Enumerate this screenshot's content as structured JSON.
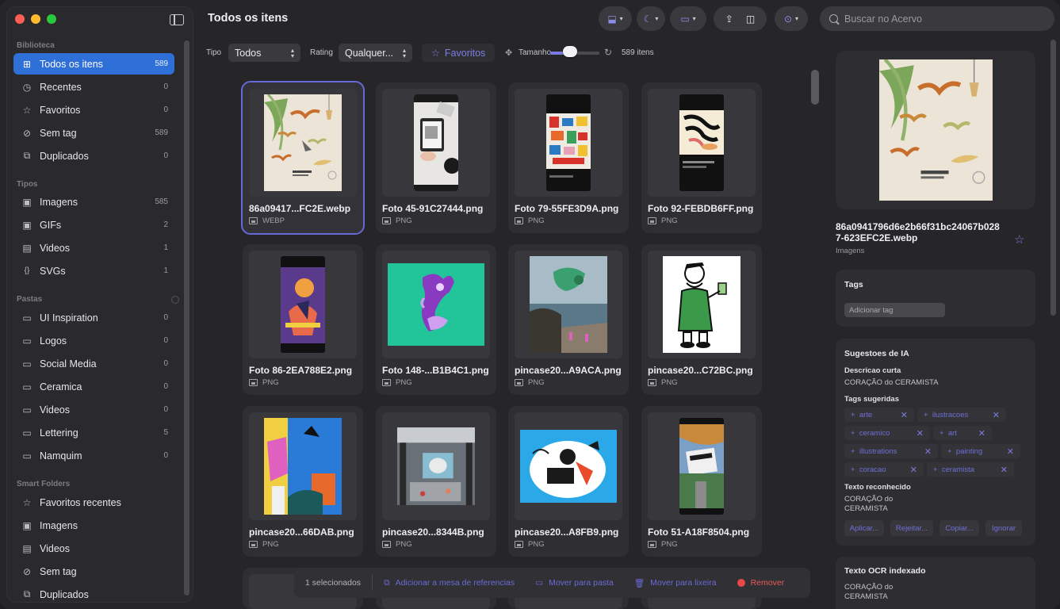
{
  "sidebar": {
    "sections": {
      "biblioteca": "Biblioteca",
      "tipos": "Tipos",
      "pastas": "Pastas",
      "smart": "Smart Folders"
    },
    "biblioteca": [
      {
        "label": "Todos os itens",
        "count": "589",
        "icon": "grid-icon"
      },
      {
        "label": "Recentes",
        "count": "0",
        "icon": "clock-icon"
      },
      {
        "label": "Favoritos",
        "count": "0",
        "icon": "star-icon"
      },
      {
        "label": "Sem tag",
        "count": "589",
        "icon": "tag-off-icon"
      },
      {
        "label": "Duplicados",
        "count": "0",
        "icon": "duplicate-icon"
      }
    ],
    "tipos": [
      {
        "label": "Imagens",
        "count": "585",
        "icon": "image-icon"
      },
      {
        "label": "GIFs",
        "count": "2",
        "icon": "gif-icon"
      },
      {
        "label": "Videos",
        "count": "1",
        "icon": "film-icon"
      },
      {
        "label": "SVGs",
        "count": "1",
        "icon": "braces-icon"
      }
    ],
    "pastas": [
      {
        "label": "UI Inspiration",
        "count": "0"
      },
      {
        "label": "Logos",
        "count": "0"
      },
      {
        "label": "Social Media",
        "count": "0"
      },
      {
        "label": "Ceramica",
        "count": "0"
      },
      {
        "label": "Videos",
        "count": "0"
      },
      {
        "label": "Lettering",
        "count": "5"
      },
      {
        "label": "Namquim",
        "count": "0"
      }
    ],
    "smart": [
      {
        "label": "Favoritos recentes",
        "icon": "star-icon"
      },
      {
        "label": "Imagens",
        "icon": "image-icon"
      },
      {
        "label": "Videos",
        "icon": "film-icon"
      },
      {
        "label": "Sem tag",
        "icon": "tag-off-icon"
      },
      {
        "label": "Duplicados",
        "icon": "duplicate-icon"
      }
    ]
  },
  "header": {
    "title": "Todos os itens",
    "search_placeholder": "Buscar no Acervo"
  },
  "filters": {
    "tipo_label": "Tipo",
    "tipo_value": "Todos",
    "rating_label": "Rating",
    "rating_value": "Qualquer...",
    "favoritos_label": "Favoritos",
    "tamanho_label": "Tamanho",
    "tamanho_level": 0.4,
    "count_text": "589 itens"
  },
  "grid": [
    {
      "name": "86a09417...FC2E.webp",
      "format": "WEBP"
    },
    {
      "name": "Foto 45-91C27444.png",
      "format": "PNG"
    },
    {
      "name": "Foto 79-55FE3D9A.png",
      "format": "PNG"
    },
    {
      "name": "Foto 92-FEBDB6FF.png",
      "format": "PNG"
    },
    {
      "name": "Foto 86-2EA788E2.png",
      "format": "PNG"
    },
    {
      "name": "Foto 148-...B1B4C1.png",
      "format": "PNG"
    },
    {
      "name": "pincase20...A9ACA.png",
      "format": "PNG"
    },
    {
      "name": "pincase20...C72BC.png",
      "format": "PNG"
    },
    {
      "name": "pincase20...66DAB.png",
      "format": "PNG"
    },
    {
      "name": "pincase20...8344B.png",
      "format": "PNG"
    },
    {
      "name": "pincase20...A8FB9.png",
      "format": "PNG"
    },
    {
      "name": "Foto 51-A18F8504.png",
      "format": "PNG"
    }
  ],
  "action_bar": {
    "selected": "1 selecionados",
    "add_ref": "Adicionar a mesa de referencias",
    "move_folder": "Mover para pasta",
    "move_trash": "Mover para lixeira",
    "remove": "Remover"
  },
  "details": {
    "file_name": "86a0941796d6e2b66f31bc24067b0287-623EFC2E.webp",
    "kind": "Imagens",
    "tags_title": "Tags",
    "add_tag_placeholder": "Adicionar tag",
    "ai_title": "Sugestoes de IA",
    "short_desc_label": "Descricao curta",
    "short_desc": "CORAÇÃO do CERAMISTA",
    "suggested_tags_label": "Tags sugeridas",
    "suggested_tags": [
      "arte",
      "ilustracoes",
      "ceramico",
      "art",
      "illustrations",
      "painting",
      "coracao",
      "ceramista"
    ],
    "recognized_label": "Texto reconhecido",
    "recognized_line1": "CORAÇÃO do",
    "recognized_line2": "CERAMISTA",
    "actions": [
      "Aplicar...",
      "Rejeitar...",
      "Copiar...",
      "Ignorar"
    ],
    "ocr_title": "Texto OCR indexado",
    "ocr_line1": "CORAÇÃO do",
    "ocr_line2": "CERAMISTA"
  }
}
